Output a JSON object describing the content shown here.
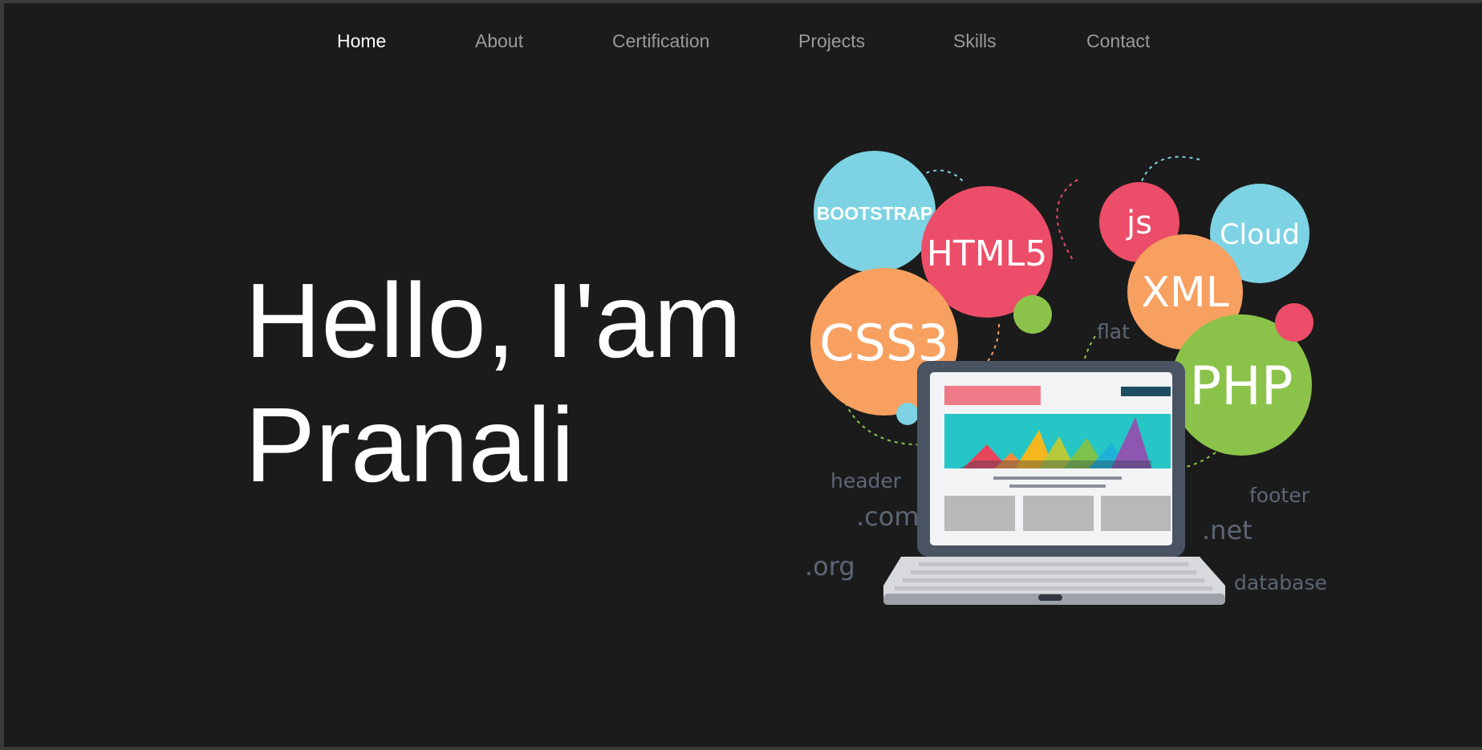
{
  "nav": {
    "items": [
      {
        "label": "Home",
        "active": true
      },
      {
        "label": "About",
        "active": false
      },
      {
        "label": "Certification",
        "active": false
      },
      {
        "label": "Projects",
        "active": false
      },
      {
        "label": "Skills",
        "active": false
      },
      {
        "label": "Contact",
        "active": false
      }
    ]
  },
  "hero": {
    "line1": "Hello, I'am",
    "line2": "Pranali"
  },
  "illustration": {
    "bubbles": {
      "bootstrap": "BOOTSTRAP",
      "html5": "HTML5",
      "css3": "CSS3",
      "js": "js",
      "cloud": "Cloud",
      "xml": "XML",
      "php": "PHP"
    },
    "words": {
      "flat": "flat",
      "header": "header",
      "com": ".com",
      "org": ".org",
      "footer": "footer",
      "net": ".net",
      "database": "database"
    },
    "colors": {
      "teal": "#7dd3e3",
      "pink": "#ec4d68",
      "orange": "#f8a060",
      "green": "#8bc34a",
      "laptop": "#4a5361",
      "word_gray": "#5d6675"
    }
  }
}
